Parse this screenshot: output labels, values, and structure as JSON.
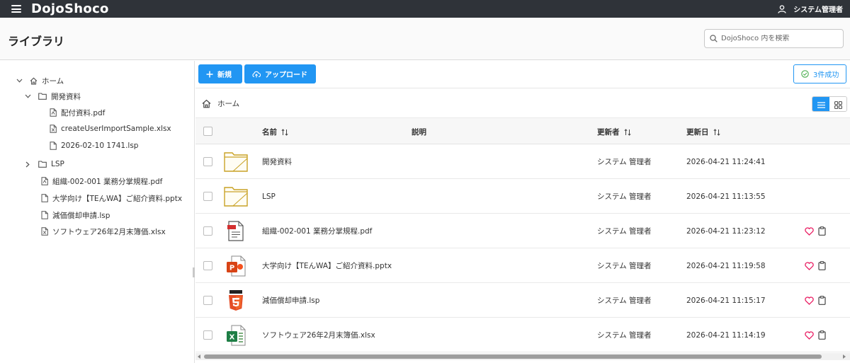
{
  "app": {
    "brand": "DojoShoco",
    "user_name": "システム管理者"
  },
  "header": {
    "title": "ライブラリ",
    "search_placeholder": "DojoShoco 内を検索"
  },
  "tree": {
    "items": [
      {
        "label": "ホーム"
      },
      {
        "label": "開発資料"
      },
      {
        "label": "配付資料.pdf"
      },
      {
        "label": "createUserImportSample.xlsx"
      },
      {
        "label": "2026-02-10 1741.lsp"
      },
      {
        "label": "LSP"
      },
      {
        "label": "組織-002-001 業務分掌規程.pdf"
      },
      {
        "label": "大学向け【TEんWA】ご紹介資料.pptx"
      },
      {
        "label": "減価償却申請.lsp"
      },
      {
        "label": "ソフトウェア26年2月末簿価.xlsx"
      }
    ]
  },
  "toolbar": {
    "new_label": "新規",
    "upload_label": "アップロード",
    "success_label": "3件成功"
  },
  "breadcrumb": {
    "home": "ホーム"
  },
  "table": {
    "columns": {
      "name": "名前",
      "description": "説明",
      "updater": "更新者",
      "updated": "更新日"
    },
    "rows": [
      {
        "name": "開発資料",
        "updater": "システム 管理者",
        "updated": "2026-04-21 11:24:41"
      },
      {
        "name": "LSP",
        "updater": "システム 管理者",
        "updated": "2026-04-21 11:13:55"
      },
      {
        "name": "組織-002-001 業務分掌規程.pdf",
        "updater": "システム 管理者",
        "updated": "2026-04-21 11:23:12"
      },
      {
        "name": "大学向け【TEんWA】ご紹介資料.pptx",
        "updater": "システム 管理者",
        "updated": "2026-04-21 11:19:58"
      },
      {
        "name": "減価償却申請.lsp",
        "updater": "システム 管理者",
        "updated": "2026-04-21 11:15:17"
      },
      {
        "name": "ソフトウェア26年2月末簿価.xlsx",
        "updater": "システム 管理者",
        "updated": "2026-04-21 11:14:19"
      }
    ]
  },
  "colors": {
    "topbar": "#2f3339",
    "accent": "#2196f3",
    "folder": "#c9a227",
    "heart": "#e91e63",
    "success": "#4caf50"
  },
  "icons": {
    "menu": "hamburger-icon",
    "user": "person-icon",
    "search": "search-icon",
    "home": "home-icon",
    "folder": "folder-icon",
    "file": "file-icon",
    "pdf": "pdf-file-icon",
    "pptx": "powerpoint-icon",
    "html": "html5-icon",
    "xlsx": "excel-icon",
    "favorite": "heart-icon",
    "clipboard": "clipboard-icon",
    "upload": "cloud-upload-icon",
    "plus": "plus-icon",
    "check": "check-circle-icon",
    "list": "list-view-icon",
    "grid": "grid-view-icon"
  }
}
